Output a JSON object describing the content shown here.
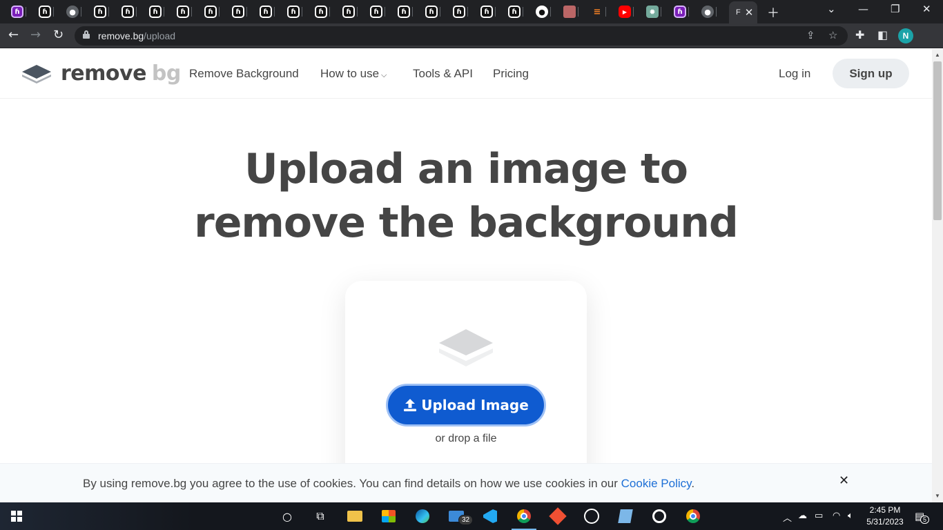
{
  "browser": {
    "active_tab_title": "F",
    "url_host": "remove.bg",
    "url_path": "/upload",
    "profile_initial": "N",
    "tabs": [
      {
        "favicon": "hotjar-icon",
        "glyph": "ɦ"
      },
      {
        "favicon": "hotjar-icon",
        "glyph": "ɦ"
      },
      {
        "favicon": "globe-icon",
        "glyph": "●"
      },
      {
        "favicon": "hotjar-icon",
        "glyph": "ɦ"
      },
      {
        "favicon": "hotjar-icon",
        "glyph": "ɦ"
      },
      {
        "favicon": "hotjar-icon",
        "glyph": "ɦ"
      },
      {
        "favicon": "hotjar-icon",
        "glyph": "ɦ"
      },
      {
        "favicon": "hotjar-icon",
        "glyph": "ɦ"
      },
      {
        "favicon": "hotjar-icon",
        "glyph": "ɦ"
      },
      {
        "favicon": "hotjar-icon",
        "glyph": "ɦ"
      },
      {
        "favicon": "hotjar-icon",
        "glyph": "ɦ"
      },
      {
        "favicon": "hotjar-icon",
        "glyph": "ɦ"
      },
      {
        "favicon": "hotjar-icon",
        "glyph": "ɦ"
      },
      {
        "favicon": "hotjar-icon",
        "glyph": "ɦ"
      },
      {
        "favicon": "hotjar-icon",
        "glyph": "ɦ"
      },
      {
        "favicon": "hotjar-icon",
        "glyph": "ɦ"
      },
      {
        "favicon": "hotjar-icon",
        "glyph": "ɦ"
      },
      {
        "favicon": "hotjar-icon",
        "glyph": "ɦ"
      },
      {
        "favicon": "hotjar-icon",
        "glyph": "ɦ"
      },
      {
        "favicon": "github-icon",
        "glyph": "●"
      },
      {
        "favicon": "photo-icon",
        "glyph": ""
      },
      {
        "favicon": "stackoverflow-icon",
        "glyph": "≡"
      },
      {
        "favicon": "youtube-icon",
        "glyph": "▶"
      },
      {
        "favicon": "chatgpt-icon",
        "glyph": "✹"
      },
      {
        "favicon": "hotjar-icon",
        "glyph": "ɦ"
      },
      {
        "favicon": "globe-icon",
        "glyph": "●"
      }
    ]
  },
  "site": {
    "logo_word": "remove",
    "logo_word_accent": "bg",
    "nav": {
      "remove_background": "Remove Background",
      "how_to_use": "How to use",
      "tools_api": "Tools & API",
      "pricing": "Pricing"
    },
    "login": "Log in",
    "signup": "Sign up"
  },
  "hero": {
    "title_line1": "Upload an image to",
    "title_line2": "remove the background"
  },
  "upload": {
    "button_label": "Upload Image",
    "drop_text": "or drop a file"
  },
  "cookie": {
    "text": "By using remove.bg you agree to the use of cookies. You can find details on how we use cookies in our ",
    "link": "Cookie Policy",
    "suffix": "."
  },
  "taskbar": {
    "mail_badge": "32",
    "clock_time": "2:45 PM",
    "clock_date": "5/31/2023",
    "notification_count": "5"
  },
  "colors": {
    "brand_text": "#454545",
    "upload_button": "#0f5bd0",
    "link": "#1d6fd6",
    "chrome_dark": "#202124"
  }
}
